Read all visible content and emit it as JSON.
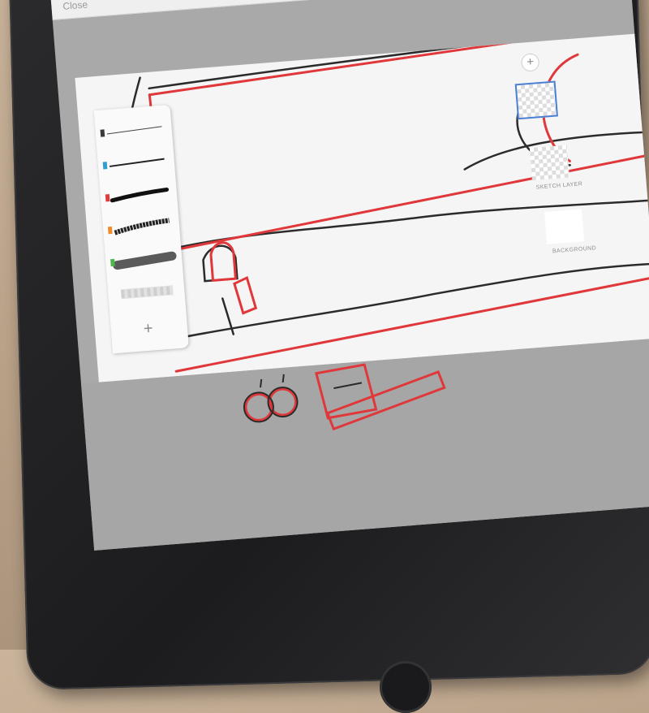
{
  "topbar": {
    "close_label": "Close"
  },
  "layers": {
    "add_icon": "+",
    "items": [
      {
        "label": ""
      },
      {
        "label": "SKETCH LAYER"
      },
      {
        "label": "BACKGROUND"
      }
    ]
  },
  "brush_panel": {
    "add_icon": "+",
    "brushes": [
      {
        "name": "thin-pencil",
        "color": "#3a3a3a"
      },
      {
        "name": "fine-liner",
        "color": "#2e9fd0"
      },
      {
        "name": "ink-brush",
        "color": "#e23a3a"
      },
      {
        "name": "dry-brush",
        "color": "#f08a2a"
      },
      {
        "name": "soft-brush",
        "color": "#4cb84c"
      },
      {
        "name": "eraser",
        "color": "#cccccc"
      }
    ]
  },
  "colors": {
    "accent": "#e0383a",
    "sketch": "#2b2b2b",
    "selection": "#4a7fd4"
  }
}
